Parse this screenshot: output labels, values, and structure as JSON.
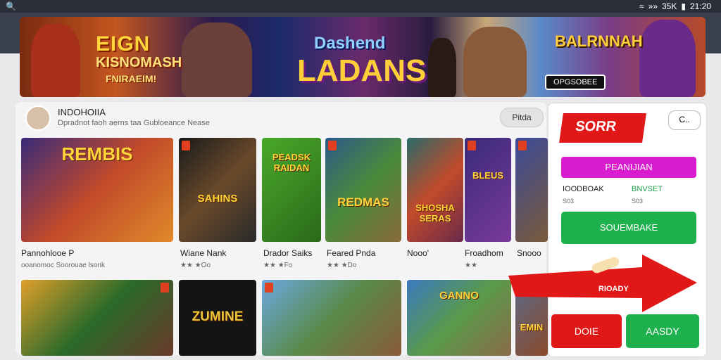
{
  "status": {
    "time": "21:20",
    "battery": "35K",
    "signal": "»»"
  },
  "banner": {
    "title_main": "EIGN",
    "title_line2": "KISNOMASH",
    "title_line3": "FNIRAEIM!",
    "center_top": "Dashend",
    "center_main": "LADANS",
    "right_title": "BALRNNAH",
    "right_button": "OPGSOBEE"
  },
  "developer": {
    "name": "INDOHOIIA",
    "subtitle": "Dpradnot faoh aerns taa  Gubloeance Nease",
    "platform_button": "Pitda"
  },
  "games": [
    {
      "tile_title": "REMBIS",
      "name": "Pannohlooe P",
      "rating": "ooanomoc  Soorouae lsonk"
    },
    {
      "tile_title": "SAHINS",
      "name": "Wiane Nank",
      "rating": "★★ ★Oo"
    },
    {
      "tile_title": "PEADSK\nRAIDAN",
      "name": "Drador Saiks",
      "rating": "★★ ★Fo"
    },
    {
      "tile_title": "REDMAS",
      "name": "Feared Pnda",
      "rating": "★★ ★Do"
    },
    {
      "tile_title": "SHOSHA\nSERAS",
      "name": "Nooo'",
      "rating": ""
    },
    {
      "tile_title": "BLEUS",
      "name": "Froadhom",
      "rating": "★★"
    },
    {
      "tile_title": "",
      "name": "Snooo",
      "rating": ""
    },
    {
      "tile_title": "",
      "name": "",
      "rating": ""
    },
    {
      "tile_title": "ZUMINE",
      "name": "",
      "rating": ""
    },
    {
      "tile_title": "",
      "name": "",
      "rating": ""
    },
    {
      "tile_title": "GANNO",
      "name": "",
      "rating": ""
    },
    {
      "tile_title": "EMIN",
      "name": "",
      "rating": ""
    }
  ],
  "panel": {
    "sign_text": "SORR",
    "close_label": "C..",
    "purple_button": "PEANIJIAN",
    "label_left": "IOODBOAK",
    "label_right": "BNVSET",
    "sub_left": "S03",
    "sub_right": "S03",
    "green_button": "SOUEMBAKE",
    "arrow_text": "RIOADY",
    "done_button": "DOIE",
    "ready_button": "AASDY"
  },
  "colors": {
    "accent_red": "#e01818",
    "accent_green": "#1fb04e",
    "accent_purple": "#d91ccf"
  }
}
